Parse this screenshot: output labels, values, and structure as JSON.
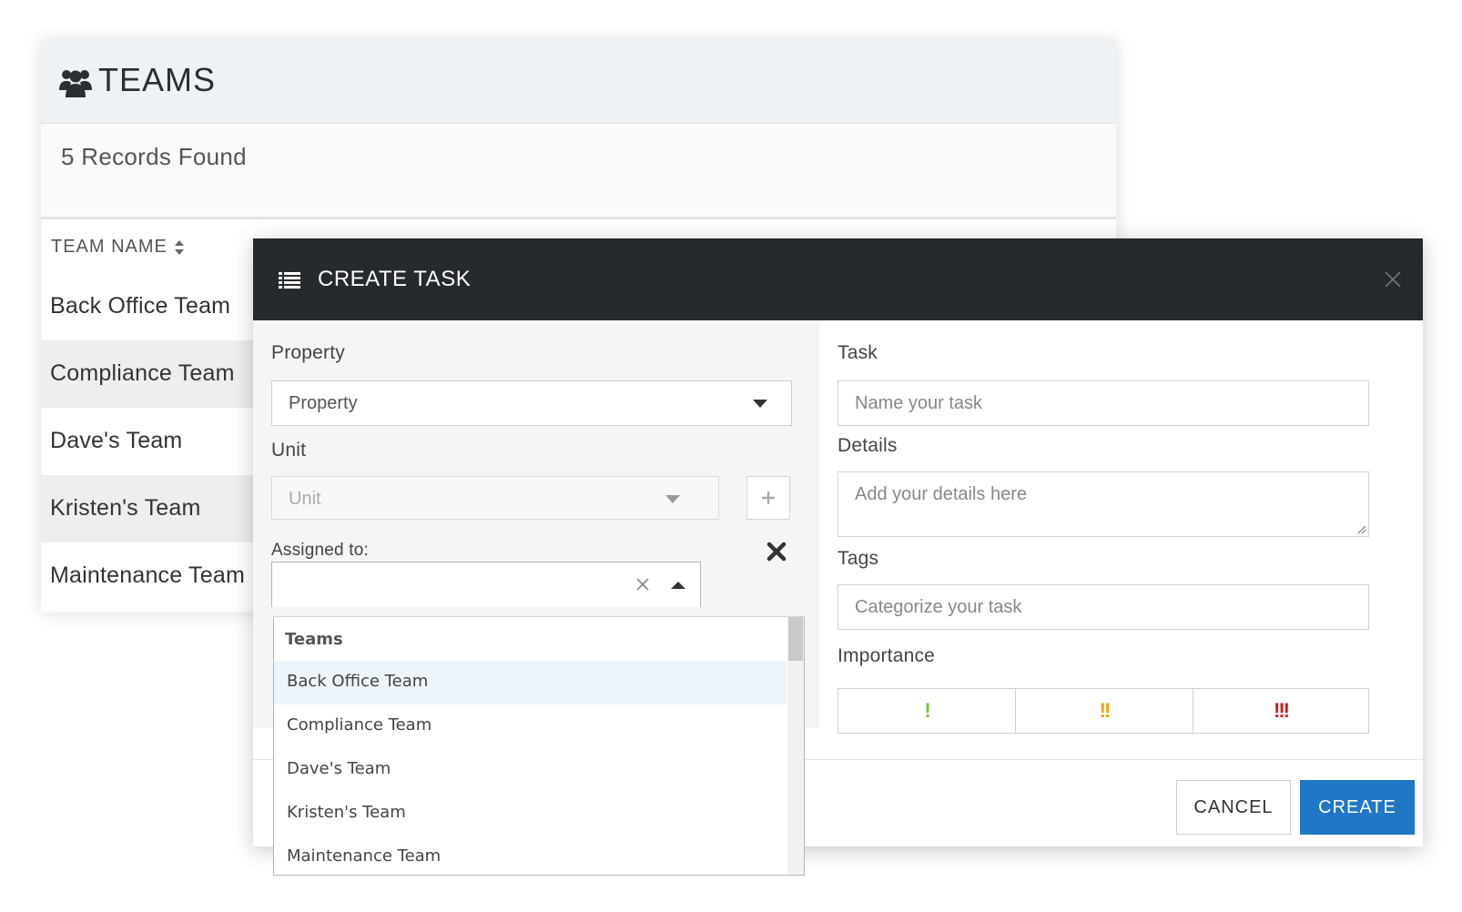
{
  "teams": {
    "title": "TEAMS",
    "records": "5 Records Found",
    "column_header": "TEAM NAME",
    "rows": [
      "Back Office Team",
      "Compliance Team",
      "Dave's Team",
      "Kristen's Team",
      "Maintenance Team"
    ]
  },
  "modal": {
    "title": "CREATE TASK",
    "property": {
      "label": "Property",
      "value": "Property"
    },
    "unit": {
      "label": "Unit",
      "value": "Unit"
    },
    "assigned": {
      "label": "Assigned to:",
      "value": ""
    },
    "task": {
      "label": "Task",
      "placeholder": "Name your task"
    },
    "details": {
      "label": "Details",
      "placeholder": "Add your details here"
    },
    "tags": {
      "label": "Tags",
      "placeholder": "Categorize your task"
    },
    "importance": {
      "label": "Importance",
      "levels": [
        {
          "text": "!",
          "color": "#7ac143"
        },
        {
          "text": "!!",
          "color": "#f0a30a"
        },
        {
          "text": "!!!",
          "color": "#d11a1a"
        }
      ]
    },
    "cancel_label": "CANCEL",
    "create_label": "CREATE"
  },
  "dropdown": {
    "group": "Teams",
    "items": [
      "Back Office Team",
      "Compliance Team",
      "Dave's Team",
      "Kristen's Team",
      "Maintenance Team"
    ]
  },
  "colors": {
    "header_dark": "#262a2e",
    "primary": "#1f77c6"
  }
}
